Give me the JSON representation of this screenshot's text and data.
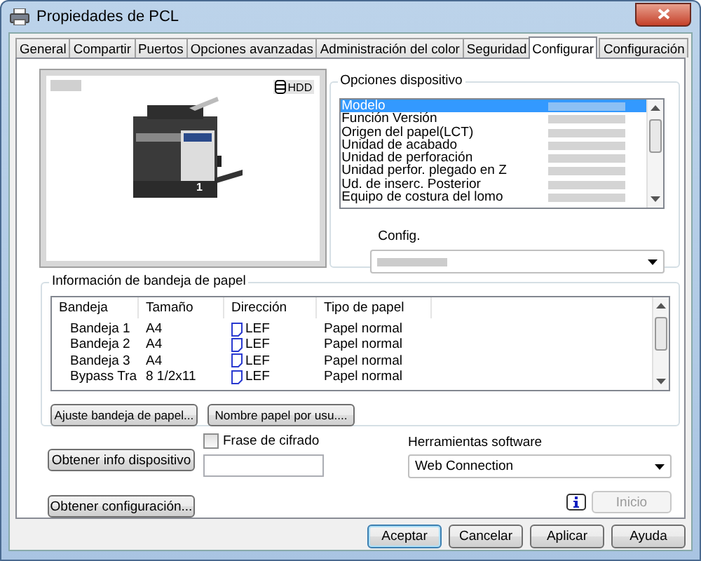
{
  "window": {
    "title": "Propiedades de PCL"
  },
  "tabs": [
    {
      "label": "General",
      "selected": false
    },
    {
      "label": "Compartir",
      "selected": false
    },
    {
      "label": "Puertos",
      "selected": false
    },
    {
      "label": "Opciones avanzadas",
      "selected": false
    },
    {
      "label": "Administración del color",
      "selected": false
    },
    {
      "label": "Seguridad",
      "selected": false
    },
    {
      "label": "Configurar",
      "selected": true
    },
    {
      "label": "Configuración",
      "selected": false
    }
  ],
  "preview": {
    "badge": "HDD",
    "tray_number": "1"
  },
  "device_options": {
    "title": "Opciones dispositivo",
    "items": [
      {
        "label": "Modelo",
        "selected": true
      },
      {
        "label": "Función Versión",
        "selected": false
      },
      {
        "label": "Origen del papel(LCT)",
        "selected": false
      },
      {
        "label": "Unidad de acabado",
        "selected": false
      },
      {
        "label": "Unidad de perforación",
        "selected": false
      },
      {
        "label": "Unidad perfor. plegado en Z",
        "selected": false
      },
      {
        "label": "Ud. de inserc. Posterior",
        "selected": false
      },
      {
        "label": "Equipo de costura del lomo",
        "selected": false
      }
    ],
    "config_label": "Config."
  },
  "tray_info": {
    "title": "Información de bandeja de papel",
    "columns": [
      "Bandeja",
      "Tamaño",
      "Dirección",
      "Tipo de papel"
    ],
    "rows": [
      {
        "tray": "Bandeja 1",
        "size": "A4",
        "direction": "LEF",
        "paper_type": "Papel normal"
      },
      {
        "tray": "Bandeja 2",
        "size": "A4",
        "direction": "LEF",
        "paper_type": "Papel normal"
      },
      {
        "tray": "Bandeja 3",
        "size": "A4",
        "direction": "LEF",
        "paper_type": "Papel normal"
      },
      {
        "tray": "Bypass Tra",
        "size": "8 1/2x11",
        "direction": "LEF",
        "paper_type": "Papel normal"
      }
    ],
    "buttons": [
      "Ajuste bandeja de papel...",
      "Nombre papel por usu...."
    ]
  },
  "get_info_button": "Obtener info dispositivo",
  "get_config_button": "Obtener configuración...",
  "passphrase": {
    "label": "Frase de cifrado",
    "checked": false
  },
  "software_tools": {
    "label": "Herramientas software",
    "value": "Web Connection"
  },
  "start_button": {
    "label": "Inicio",
    "disabled": true
  },
  "dialog_buttons": [
    {
      "label": "Aceptar",
      "default": true
    },
    {
      "label": "Cancelar",
      "default": false
    },
    {
      "label": "Aplicar",
      "default": false
    },
    {
      "label": "Ayuda",
      "default": false
    }
  ]
}
